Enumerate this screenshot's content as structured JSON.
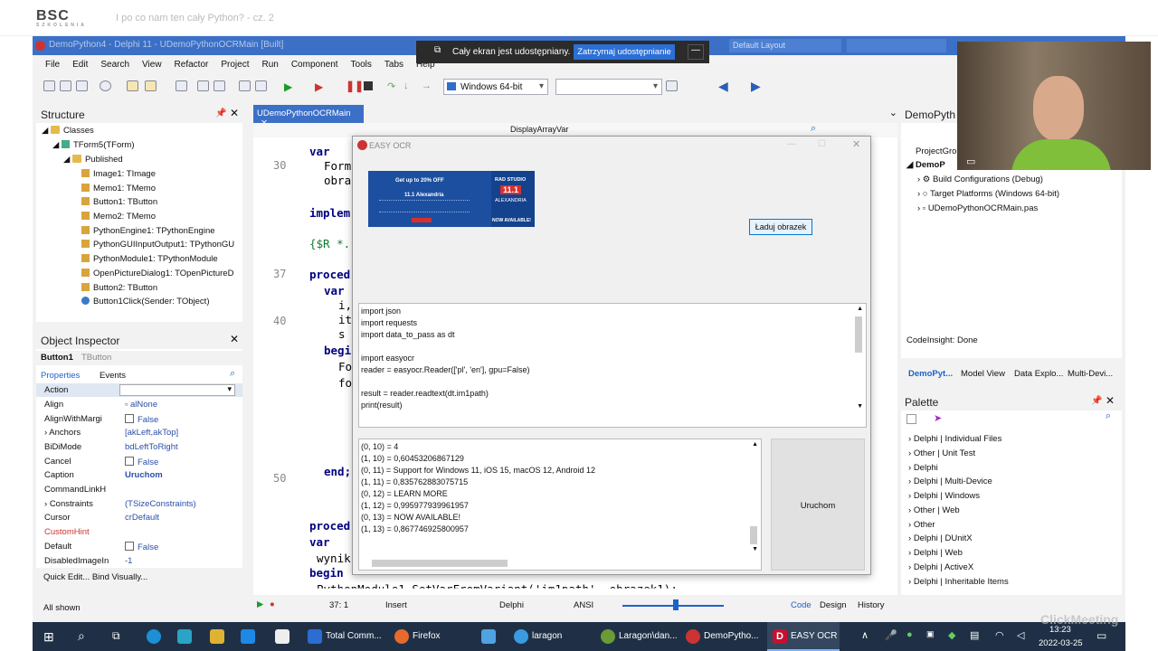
{
  "top": {
    "logo": "BSC",
    "logo_sub": "SZKOLENIA",
    "title": "I po co nam ten cały Python? - cz. 2"
  },
  "ide": {
    "title": "DemoPython4 - Delphi 11 - UDemoPythonOCRMain [Built]",
    "menu": [
      "File",
      "Edit",
      "Search",
      "View",
      "Refactor",
      "Project",
      "Run",
      "Component",
      "Tools",
      "Tabs",
      "Help"
    ],
    "platform": "Windows 64-bit",
    "layout": "Default Layout",
    "structure": {
      "title": "Structure",
      "items": [
        "Classes",
        "TForm5(TForm)",
        "Published",
        "Image1: TImage",
        "Memo1: TMemo",
        "Button1: TButton",
        "Memo2: TMemo",
        "PythonEngine1: TPythonEngine",
        "PythonGUIInputOutput1: TPythonGU",
        "PythonModule1: TPythonModule",
        "OpenPictureDialog1: TOpenPictureD",
        "Button2: TButton",
        "Button1Click(Sender: TObject)"
      ]
    },
    "inspector": {
      "title": "Object Inspector",
      "object": "Button1",
      "object_type": "TButton",
      "tab_props": "Properties",
      "tab_events": "Events",
      "rows": [
        {
          "name": "Action",
          "value": ""
        },
        {
          "name": "Align",
          "value": "alNone"
        },
        {
          "name": "AlignWithMargi",
          "value": "False"
        },
        {
          "name": "Anchors",
          "value": "[akLeft,akTop]"
        },
        {
          "name": "BiDiMode",
          "value": "bdLeftToRight"
        },
        {
          "name": "Cancel",
          "value": "False"
        },
        {
          "name": "Caption",
          "value": "Uruchom"
        },
        {
          "name": "CommandLinkH",
          "value": ""
        },
        {
          "name": "Constraints",
          "value": "(TSizeConstraints)"
        },
        {
          "name": "Cursor",
          "value": "crDefault"
        },
        {
          "name": "CustomHint",
          "value": ""
        },
        {
          "name": "Default",
          "value": "False"
        },
        {
          "name": "DisabledImageIn",
          "value": "-1"
        }
      ],
      "footer": "Quick Edit... Bind Visually...",
      "shown": "All shown"
    },
    "editor": {
      "tab": "UDemoPythonOCRMain",
      "method": "DisplayArrayVar",
      "line_numbers": [
        "30",
        "37",
        "40",
        "50"
      ],
      "lines": [
        "var",
        "Form",
        "obra",
        "implem",
        "{$R *.",
        "proced",
        "var",
        "i,",
        "it",
        "s",
        "begi",
        "Fo",
        "fo",
        "end;",
        "proced",
        "var",
        "wynik",
        "begin",
        "PythonModule1.SetVarFromVariant('im1path', obrazek1);"
      ]
    },
    "status": {
      "pos": "37: 1",
      "mode": "Insert",
      "lang": "Delphi",
      "enc": "ANSI",
      "tabs": [
        "Code",
        "Design",
        "History"
      ]
    },
    "project": {
      "title": "DemoPyth",
      "group": "ProjectGro",
      "items": [
        "DemoP",
        "Build Configurations (Debug)",
        "Target Platforms (Windows 64-bit)",
        "UDemoPythonOCRMain.pas"
      ],
      "codeinsight": "CodeInsight: Done",
      "tabs": [
        "DemoPyt...",
        "Model View",
        "Data Explo...",
        "Multi-Devi..."
      ]
    },
    "palette": {
      "title": "Palette",
      "items": [
        "Delphi | Individual Files",
        "Other | Unit Test",
        "Delphi",
        "Delphi | Multi-Device",
        "Delphi | Windows",
        "Other | Web",
        "Other",
        "Delphi | DUnitX",
        "Delphi | Web",
        "Delphi | ActiveX",
        "Delphi | Inheritable Items"
      ]
    }
  },
  "ocr": {
    "title": "EASY OCR",
    "load_button": "Ładuj obrazek",
    "run_button": "Uruchom",
    "ad": {
      "line1": "Get up to 20% OFF",
      "line2": "11.1 Alexandria",
      "brand": "RAD STUDIO",
      "ver": "11.1",
      "city": "ALEXANDRIA",
      "cta": "NOW AVAILABLE!"
    },
    "script": [
      "import json",
      "import requests",
      "import data_to_pass as dt",
      "",
      "import easyocr",
      "reader = easyocr.Reader(['pl', 'en'], gpu=False)",
      "",
      "result = reader.readtext(dt.im1path)",
      "print(result)"
    ],
    "output": [
      "(0, 10) = 4",
      "(1, 10) = 0,60453206867129",
      "(0, 11) = Support for Windows 11, iOS 15, macOS 12, Android 12",
      "(1, 11) = 0,835762883075715",
      "(0, 12) = LEARN MORE",
      "(1, 12) = 0,995977939961957",
      "(0, 13) = NOW AVAILABLE!",
      "(1, 13) = 0,867746925800957"
    ]
  },
  "share": {
    "text": "Cały ekran jest udostępniany.",
    "stop": "Zatrzymaj udostępnianie"
  },
  "taskbar": {
    "apps": [
      "Total Comm...",
      "Firefox",
      "laragon",
      "Laragon\\dan...",
      "DemoPytho...",
      "EASY OCR"
    ],
    "time": "13:23",
    "date": "2022-03-25"
  },
  "watermark": "ClickMeeting"
}
